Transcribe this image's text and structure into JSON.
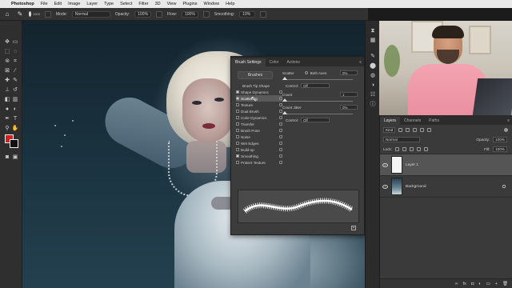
{
  "menubar": {
    "app_name": "Photoshop",
    "items": [
      "File",
      "Edit",
      "Image",
      "Layer",
      "Type",
      "Select",
      "Filter",
      "3D",
      "View",
      "Plugins",
      "Window",
      "Help"
    ]
  },
  "options_bar": {
    "brush_size": "1500",
    "mode_label": "Mode:",
    "mode_value": "Normal",
    "opacity_label": "Opacity:",
    "opacity_value": "100%",
    "flow_label": "Flow:",
    "flow_value": "100%",
    "smoothing_label": "Smoothing:",
    "smoothing_value": "10%"
  },
  "colors": {
    "foreground": "#d62020",
    "background": "#111111"
  },
  "brush_settings": {
    "tabs": [
      "Brush Settings",
      "Color",
      "Actions"
    ],
    "brushes_button": "Brushes",
    "tip_shape": "Brush Tip Shape",
    "options": [
      {
        "label": "Shape Dynamics",
        "checked": true
      },
      {
        "label": "Scattering",
        "checked": true,
        "selected": true
      },
      {
        "label": "Texture",
        "checked": false
      },
      {
        "label": "Dual Brush",
        "checked": false
      },
      {
        "label": "Color Dynamics",
        "checked": false
      },
      {
        "label": "Transfer",
        "checked": false
      },
      {
        "label": "Brush Pose",
        "checked": false
      },
      {
        "label": "Noise",
        "checked": false
      },
      {
        "label": "Wet Edges",
        "checked": false
      },
      {
        "label": "Build-up",
        "checked": false
      },
      {
        "label": "Smoothing",
        "checked": true
      },
      {
        "label": "Protect Texture",
        "checked": false
      }
    ],
    "scatter_label": "Scatter",
    "both_axes_label": "Both Axes",
    "scatter_value": "0%",
    "control_label": "Control:",
    "control_value": "Off",
    "count_label": "Count",
    "count_value": "1",
    "count_jitter_label": "Count Jitter",
    "count_jitter_value": "0%",
    "control2_label": "Control:",
    "control2_value": "Off"
  },
  "layers_panel": {
    "tabs": [
      "Layers",
      "Channels",
      "Paths"
    ],
    "filter_value": "Kind",
    "blend_mode": "Normal",
    "opacity_label": "Opacity:",
    "opacity_value": "100%",
    "lock_label": "Lock:",
    "fill_label": "Fill:",
    "fill_value": "100%",
    "layers": [
      {
        "name": "Layer 1",
        "selected": true
      },
      {
        "name": "Background",
        "selected": false
      }
    ]
  }
}
